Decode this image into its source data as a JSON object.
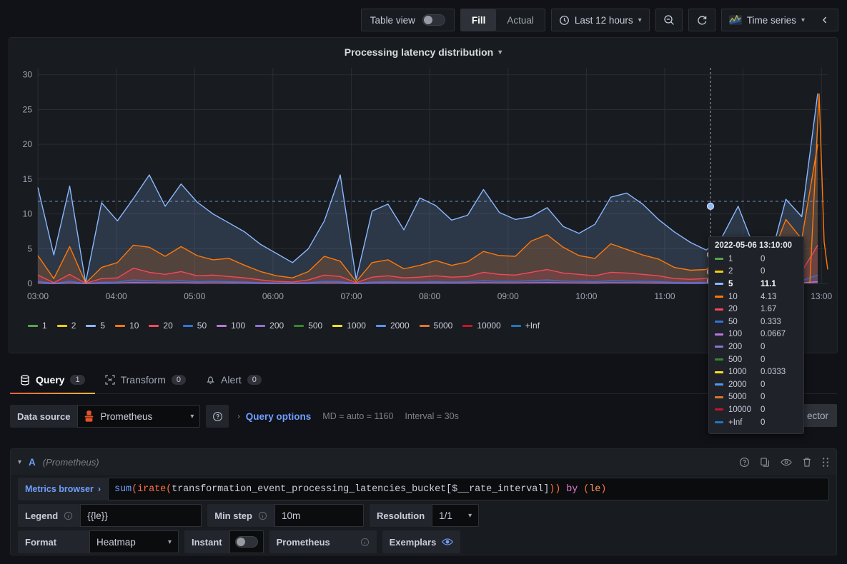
{
  "toolbar": {
    "table_view_label": "Table view",
    "table_view_on": false,
    "fill_label": "Fill",
    "actual_label": "Actual",
    "time_range": "Last 12 hours",
    "zoom_out_icon": "zoom-out-icon",
    "refresh_icon": "refresh-icon",
    "viz_type": "Time series",
    "collapse_icon": "chevron-left-icon"
  },
  "panel": {
    "title": "Processing latency distribution"
  },
  "chart_data": {
    "type": "area",
    "title": "Processing latency distribution",
    "xlabel": "",
    "ylabel": "",
    "ylim": [
      0,
      31
    ],
    "yticks": [
      0,
      5,
      10,
      15,
      20,
      25,
      30
    ],
    "xticks": [
      "03:00",
      "04:00",
      "05:00",
      "06:00",
      "07:00",
      "08:00",
      "09:00",
      "10:00",
      "11:00",
      "12:00",
      "13:00"
    ],
    "grid": true,
    "legend_position": "bottom",
    "threshold_line": 11.8,
    "cursor_time": "2022-05-06 13:10:00",
    "colors": {
      "1": "#56a64b",
      "2": "#f2cc0c",
      "5": "#8ab8ff",
      "10": "#ff780a",
      "20": "#f2495c",
      "50": "#3274d9",
      "100": "#b877d9",
      "200": "#8f72d1",
      "500": "#37872d",
      "1000": "#fade2a",
      "2000": "#5794f2",
      "5000": "#e0752d",
      "10000": "#c4162a",
      "+Inf": "#1f78c1"
    },
    "series": [
      {
        "name": "1",
        "values": [
          0,
          0,
          0,
          0,
          0,
          0,
          0,
          0,
          0,
          0,
          0,
          0,
          0,
          0,
          0,
          0,
          0,
          0,
          0,
          0,
          0,
          0,
          0,
          0,
          0,
          0,
          0,
          0,
          0,
          0,
          0,
          0,
          0,
          0,
          0,
          0,
          0,
          0,
          0,
          0,
          0,
          0,
          0,
          0,
          0,
          0,
          0,
          0,
          0,
          0,
          0,
          0,
          0,
          0,
          0,
          0,
          0,
          0,
          0,
          0,
          0
        ]
      },
      {
        "name": "2",
        "values": [
          0,
          0,
          0,
          0,
          0,
          0,
          0,
          0,
          0,
          0,
          0,
          0,
          0,
          0,
          0,
          0,
          0,
          0,
          0,
          0,
          0,
          0,
          0,
          0,
          0,
          0,
          0,
          0,
          0,
          0,
          0,
          0,
          0,
          0,
          0,
          0,
          0,
          0,
          0,
          0,
          0,
          0,
          0,
          0,
          0,
          0,
          0,
          0,
          0,
          0,
          0,
          0,
          0,
          0,
          0,
          0,
          0,
          0,
          0,
          0,
          0
        ]
      },
      {
        "name": "5",
        "values": [
          13.8,
          4.1,
          14.0,
          0.1,
          11.6,
          9.0,
          12.2,
          15.6,
          11.1,
          14.3,
          11.7,
          10.0,
          8.7,
          7.4,
          5.6,
          4.3,
          3.0,
          5.0,
          9.0,
          15.6,
          0.6,
          10.4,
          11.4,
          7.7,
          12.3,
          11.2,
          9.1,
          9.8,
          13.5,
          10.2,
          9.2,
          9.6,
          10.9,
          8.2,
          7.2,
          8.5,
          12.4,
          13.0,
          11.4,
          9.2,
          7.4,
          5.9,
          4.8,
          6.7,
          11.1,
          5.2,
          3.4,
          12.1,
          9.6,
          27.3
        ]
      },
      {
        "name": "10",
        "values": [
          4.0,
          0.7,
          5.3,
          0.05,
          2.3,
          3.0,
          5.5,
          5.2,
          3.9,
          5.3,
          4.0,
          3.4,
          3.6,
          2.6,
          1.7,
          1.1,
          0.8,
          1.7,
          3.9,
          3.2,
          0.25,
          3.0,
          3.4,
          2.1,
          2.6,
          3.3,
          2.6,
          3.1,
          4.6,
          4.0,
          3.9,
          6.1,
          7.0,
          5.2,
          4.0,
          3.6,
          5.7,
          4.9,
          4.1,
          3.5,
          2.3,
          1.9,
          2.0,
          4.13,
          4.13,
          5.6,
          3.3,
          9.2,
          6.4,
          20.0
        ]
      },
      {
        "name": "20",
        "values": [
          1.2,
          0.1,
          1.3,
          0.02,
          0.7,
          0.8,
          2.2,
          1.6,
          1.3,
          1.7,
          1.1,
          1.2,
          1.0,
          0.8,
          0.5,
          0.3,
          0.2,
          0.5,
          1.2,
          1.0,
          0.1,
          0.9,
          1.1,
          0.8,
          0.9,
          1.1,
          0.9,
          1.0,
          1.6,
          1.3,
          1.2,
          1.6,
          2.0,
          1.5,
          1.3,
          1.1,
          1.6,
          1.5,
          1.3,
          1.1,
          0.7,
          0.6,
          0.7,
          1.67,
          1.67,
          1.4,
          1.0,
          2.2,
          1.7,
          5.5
        ]
      },
      {
        "name": "50",
        "values": [
          0.3,
          0.02,
          0.3,
          0,
          0.15,
          0.2,
          0.5,
          0.4,
          0.3,
          0.4,
          0.25,
          0.3,
          0.25,
          0.2,
          0.1,
          0.07,
          0.05,
          0.1,
          0.3,
          0.25,
          0.02,
          0.2,
          0.25,
          0.2,
          0.2,
          0.25,
          0.2,
          0.25,
          0.4,
          0.3,
          0.3,
          0.4,
          0.5,
          0.35,
          0.3,
          0.25,
          0.4,
          0.35,
          0.3,
          0.25,
          0.15,
          0.12,
          0.15,
          0.333,
          0.333,
          0.35,
          0.25,
          0.5,
          0.4,
          1.2
        ]
      },
      {
        "name": "100",
        "values": [
          0.06,
          0,
          0.06,
          0,
          0.03,
          0.04,
          0.1,
          0.08,
          0.06,
          0.08,
          0.05,
          0.06,
          0.05,
          0.04,
          0.02,
          0.01,
          0.01,
          0.02,
          0.06,
          0.05,
          0,
          0.04,
          0.05,
          0.04,
          0.04,
          0.05,
          0.04,
          0.05,
          0.08,
          0.06,
          0.06,
          0.08,
          0.1,
          0.07,
          0.06,
          0.05,
          0.08,
          0.07,
          0.06,
          0.05,
          0.03,
          0.02,
          0.03,
          0.0667,
          0.0667,
          0.07,
          0.05,
          0.1,
          0.08,
          0.25
        ]
      },
      {
        "name": "200",
        "values": [
          0,
          0,
          0,
          0,
          0,
          0,
          0,
          0,
          0,
          0,
          0,
          0,
          0,
          0,
          0,
          0,
          0,
          0,
          0,
          0,
          0,
          0,
          0,
          0,
          0,
          0,
          0,
          0,
          0,
          0,
          0,
          0,
          0,
          0,
          0,
          0,
          0,
          0,
          0,
          0,
          0,
          0,
          0,
          0,
          0,
          0,
          0,
          0,
          0,
          0
        ]
      },
      {
        "name": "500",
        "values": [
          0,
          0,
          0,
          0,
          0,
          0,
          0,
          0,
          0,
          0,
          0,
          0,
          0,
          0,
          0,
          0,
          0,
          0,
          0,
          0,
          0,
          0,
          0,
          0,
          0,
          0,
          0,
          0,
          0,
          0,
          0,
          0,
          0,
          0,
          0,
          0,
          0,
          0,
          0,
          0,
          0,
          0,
          0,
          0,
          0,
          0,
          0,
          0,
          0,
          0
        ]
      },
      {
        "name": "1000",
        "values": [
          0,
          0,
          0,
          0,
          0,
          0,
          0,
          0,
          0,
          0,
          0,
          0,
          0,
          0,
          0,
          0,
          0,
          0,
          0,
          0,
          0,
          0,
          0,
          0,
          0,
          0,
          0,
          0,
          0,
          0,
          0,
          0,
          0,
          0,
          0,
          0,
          0,
          0,
          0,
          0,
          0,
          0,
          0,
          0.0333,
          0.0333,
          0,
          0,
          0,
          0,
          0.05
        ]
      },
      {
        "name": "2000",
        "values": [
          0,
          0,
          0,
          0,
          0,
          0,
          0,
          0,
          0,
          0,
          0,
          0,
          0,
          0,
          0,
          0,
          0,
          0,
          0,
          0,
          0,
          0,
          0,
          0,
          0,
          0,
          0,
          0,
          0,
          0,
          0,
          0,
          0,
          0,
          0,
          0,
          0,
          0,
          0,
          0,
          0,
          0,
          0,
          0,
          0,
          0,
          0,
          0,
          0,
          0
        ]
      },
      {
        "name": "5000",
        "values": [
          0,
          0,
          0,
          0,
          0,
          0,
          0,
          0,
          0,
          0,
          0,
          0,
          0,
          0,
          0,
          0,
          0,
          0,
          0,
          0,
          0,
          0,
          0,
          0,
          0,
          0,
          0,
          0,
          0,
          0,
          0,
          0,
          0,
          0,
          0,
          0,
          0,
          0,
          0,
          0,
          0,
          0,
          0,
          0,
          0,
          0,
          0,
          0,
          0,
          0
        ]
      },
      {
        "name": "10000",
        "values": [
          0,
          0,
          0,
          0,
          0,
          0,
          0,
          0,
          0,
          0,
          0,
          0,
          0,
          0,
          0,
          0,
          0,
          0,
          0,
          0,
          0,
          0,
          0,
          0,
          0,
          0,
          0,
          0,
          0,
          0,
          0,
          0,
          0,
          0,
          0,
          0,
          0,
          0,
          0,
          0,
          0,
          0,
          0,
          0,
          0,
          0,
          0,
          0,
          0,
          0
        ]
      },
      {
        "name": "+Inf",
        "values": [
          0,
          0,
          0,
          0,
          0,
          0,
          0,
          0,
          0,
          0,
          0,
          0,
          0,
          0,
          0,
          0,
          0,
          0,
          0,
          0,
          0,
          0,
          0,
          0,
          0,
          0,
          0,
          0,
          0,
          0,
          0,
          0,
          0,
          0,
          0,
          0,
          0,
          0,
          0,
          0,
          0,
          0,
          0,
          0,
          0,
          0,
          0,
          0,
          0,
          0
        ]
      }
    ]
  },
  "legend": {
    "items": [
      {
        "label": "1",
        "color": "#56a64b"
      },
      {
        "label": "2",
        "color": "#f2cc0c"
      },
      {
        "label": "5",
        "color": "#8ab8ff"
      },
      {
        "label": "10",
        "color": "#ff780a"
      },
      {
        "label": "20",
        "color": "#f2495c"
      },
      {
        "label": "50",
        "color": "#3274d9"
      },
      {
        "label": "100",
        "color": "#b877d9"
      },
      {
        "label": "200",
        "color": "#8f72d1"
      },
      {
        "label": "500",
        "color": "#37872d"
      },
      {
        "label": "1000",
        "color": "#fade2a"
      },
      {
        "label": "2000",
        "color": "#5794f2"
      },
      {
        "label": "5000",
        "color": "#e0752d"
      },
      {
        "label": "10000",
        "color": "#c4162a"
      },
      {
        "label": "+Inf",
        "color": "#1f78c1"
      }
    ]
  },
  "tooltip": {
    "timestamp": "2022-05-06 13:10:00",
    "highlight": "5",
    "rows": [
      {
        "name": "1",
        "value": "0",
        "color": "#56a64b"
      },
      {
        "name": "2",
        "value": "0",
        "color": "#f2cc0c"
      },
      {
        "name": "5",
        "value": "11.1",
        "color": "#8ab8ff"
      },
      {
        "name": "10",
        "value": "4.13",
        "color": "#ff780a"
      },
      {
        "name": "20",
        "value": "1.67",
        "color": "#f2495c"
      },
      {
        "name": "50",
        "value": "0.333",
        "color": "#3274d9"
      },
      {
        "name": "100",
        "value": "0.0667",
        "color": "#b877d9"
      },
      {
        "name": "200",
        "value": "0",
        "color": "#8f72d1"
      },
      {
        "name": "500",
        "value": "0",
        "color": "#37872d"
      },
      {
        "name": "1000",
        "value": "0.0333",
        "color": "#fade2a"
      },
      {
        "name": "2000",
        "value": "0",
        "color": "#5794f2"
      },
      {
        "name": "5000",
        "value": "0",
        "color": "#e0752d"
      },
      {
        "name": "10000",
        "value": "0",
        "color": "#c4162a"
      },
      {
        "name": "+Inf",
        "value": "0",
        "color": "#1f78c1"
      }
    ]
  },
  "tabs": [
    {
      "label": "Query",
      "count": "1",
      "icon": "database-icon",
      "active": true
    },
    {
      "label": "Transform",
      "count": "0",
      "icon": "transform-icon",
      "active": false
    },
    {
      "label": "Alert",
      "count": "0",
      "icon": "bell-icon",
      "active": false
    }
  ],
  "datasource_row": {
    "label": "Data source",
    "value": "Prometheus",
    "help_icon": "help-circle-icon",
    "query_options_label": "Query options",
    "max_datapoints": "MD = auto = 1160",
    "interval": "Interval = 30s",
    "builder_selector": "ector"
  },
  "query": {
    "ref_id": "A",
    "datasource": "(Prometheus)",
    "metrics_browser_label": "Metrics browser",
    "expression": "sum(irate(transformation_event_processing_latencies_bucket[$__rate_interval])) by (le)",
    "expr_tokens": [
      {
        "t": "sum",
        "c": "fn"
      },
      {
        "t": "(",
        "c": "paren"
      },
      {
        "t": "irate",
        "c": "fn2"
      },
      {
        "t": "(",
        "c": "paren"
      },
      {
        "t": "transformation_event_processing_latencies_bucket[$__rate_interval]",
        "c": "id"
      },
      {
        "t": "))",
        "c": "paren"
      },
      {
        "t": " by ",
        "c": "kw"
      },
      {
        "t": "(",
        "c": "paren"
      },
      {
        "t": "le",
        "c": "le"
      },
      {
        "t": ")",
        "c": "paren"
      }
    ],
    "legend_label": "Legend",
    "legend_value": "{{le}}",
    "min_step_label": "Min step",
    "min_step_value": "10m",
    "resolution_label": "Resolution",
    "resolution_value": "1/1",
    "format_label": "Format",
    "format_value": "Heatmap",
    "instant_label": "Instant",
    "instant_on": false,
    "exemplars_prometheus_label": "Prometheus",
    "exemplars_label": "Exemplars"
  }
}
